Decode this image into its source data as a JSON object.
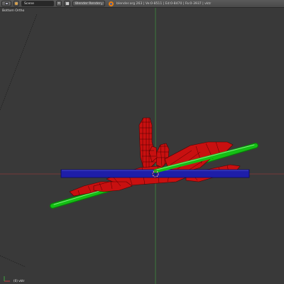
{
  "header": {
    "scene_name": "Scene",
    "render_engine": "Blender Render",
    "stats": "blender.org 263 | Ve:0-8511 | Ed:0-8470 | Fa:0-3937 | vktr"
  },
  "viewport": {
    "view_label": "Bottom Ortho",
    "object_label": "(0) vktr"
  },
  "colors": {
    "mesh": "#d01010",
    "green_bar": "#0fb10f",
    "blue_bar": "#1e1ea8",
    "background": "#393939"
  }
}
